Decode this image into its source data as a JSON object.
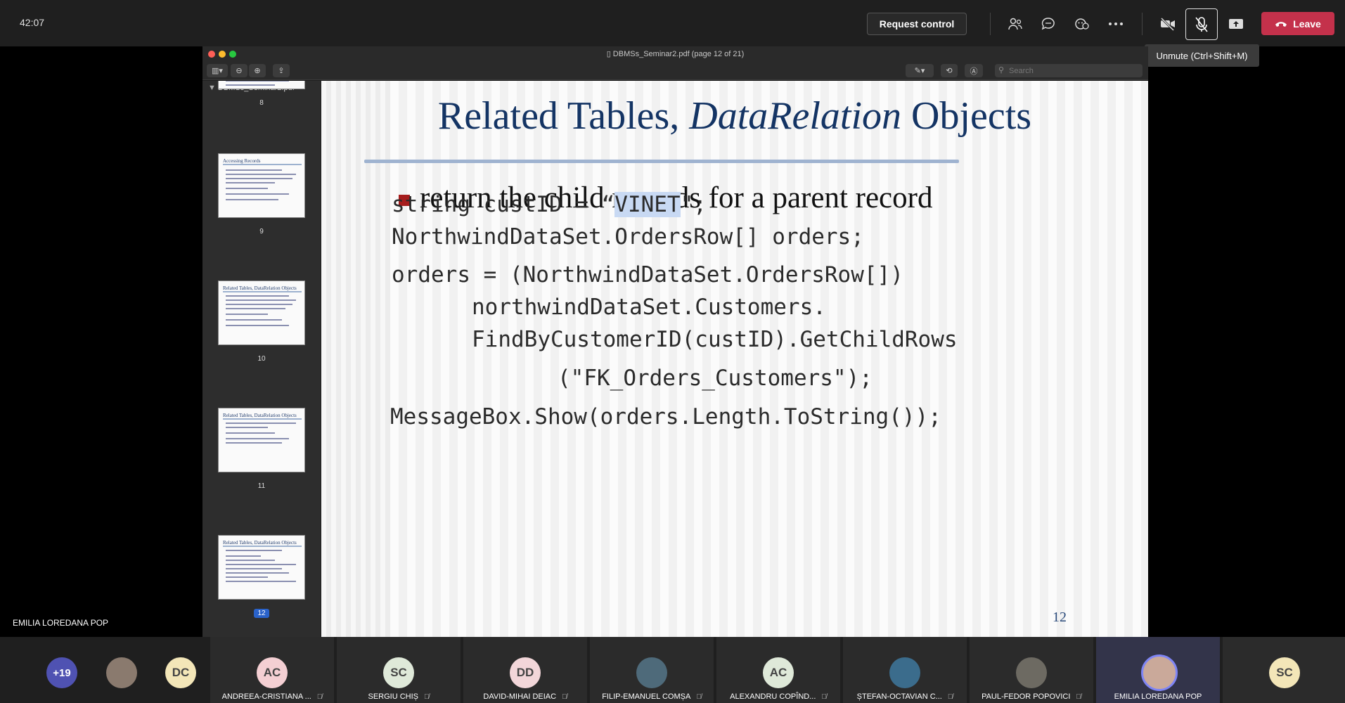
{
  "meeting": {
    "timer": "42:07",
    "request_control_label": "Request control",
    "leave_label": "Leave",
    "unmute_tooltip": "Unmute (Ctrl+Shift+M)",
    "presenter_label": "EMILIA LOREDANA POP",
    "leave_color": "#c4314b"
  },
  "pdf": {
    "window_title": "DBMSs_Seminar2.pdf (page 12 of 21)",
    "sidebar_title": "DBMSs_Seminar2.pdf",
    "search_placeholder": "Search",
    "thumbnails": [
      {
        "num": "8"
      },
      {
        "num": "9",
        "head": "Accessing Records"
      },
      {
        "num": "10",
        "head": "Related Tables, DataRelation Objects"
      },
      {
        "num": "11",
        "head": "Related Tables, DataRelation Objects"
      },
      {
        "num": "12",
        "head": "Related Tables, DataRelation Objects",
        "selected": true
      }
    ]
  },
  "slide": {
    "title_part1": "Related Tables, ",
    "title_italic": "DataRelation",
    "title_part2": " Objects",
    "bullet": "return the child records for a parent record",
    "code_l1_a": "string custID = “",
    "code_l1_hl": "VINET",
    "code_l1_b": "\";",
    "code_l2": "NorthwindDataSet.OrdersRow[] orders;",
    "code_l3": "orders = (NorthwindDataSet.OrdersRow[])",
    "code_l4": "northwindDataSet.Customers.",
    "code_l5": "FindByCustomerID(custID).GetChildRows",
    "code_l6": "(\"FK_Orders_Customers\");",
    "code_l7": "MessageBox.Show(orders.Length.ToString());",
    "page_number": "12"
  },
  "participants": {
    "overflow": "+19",
    "tile_dc": "DC",
    "tile_sc_end": "SC",
    "list": [
      {
        "initials": "AC",
        "name": "ANDREEA-CRISTIANA ...",
        "color": "#f4cfd3"
      },
      {
        "initials": "SC",
        "name": "SERGIU CHIȘ",
        "color": "#dfe9d9"
      },
      {
        "initials": "DD",
        "name": "DAVID-MIHAI DEIAC",
        "color": "#f2d6d9"
      },
      {
        "initials": "",
        "name": "FILIP-EMANUEL COMȘA",
        "color": "#4e6a7a"
      },
      {
        "initials": "AC",
        "name": "ALEXANDRU COPÎND...",
        "color": "#dfe9d9"
      },
      {
        "initials": "",
        "name": "ȘTEFAN-OCTAVIAN C...",
        "color": "#3b6c8c"
      },
      {
        "initials": "",
        "name": "PAUL-FEDOR POPOVICI",
        "color": "#6d6a62"
      },
      {
        "initials": "",
        "name": "EMILIA LOREDANA POP",
        "color": "#caa99a"
      }
    ]
  }
}
